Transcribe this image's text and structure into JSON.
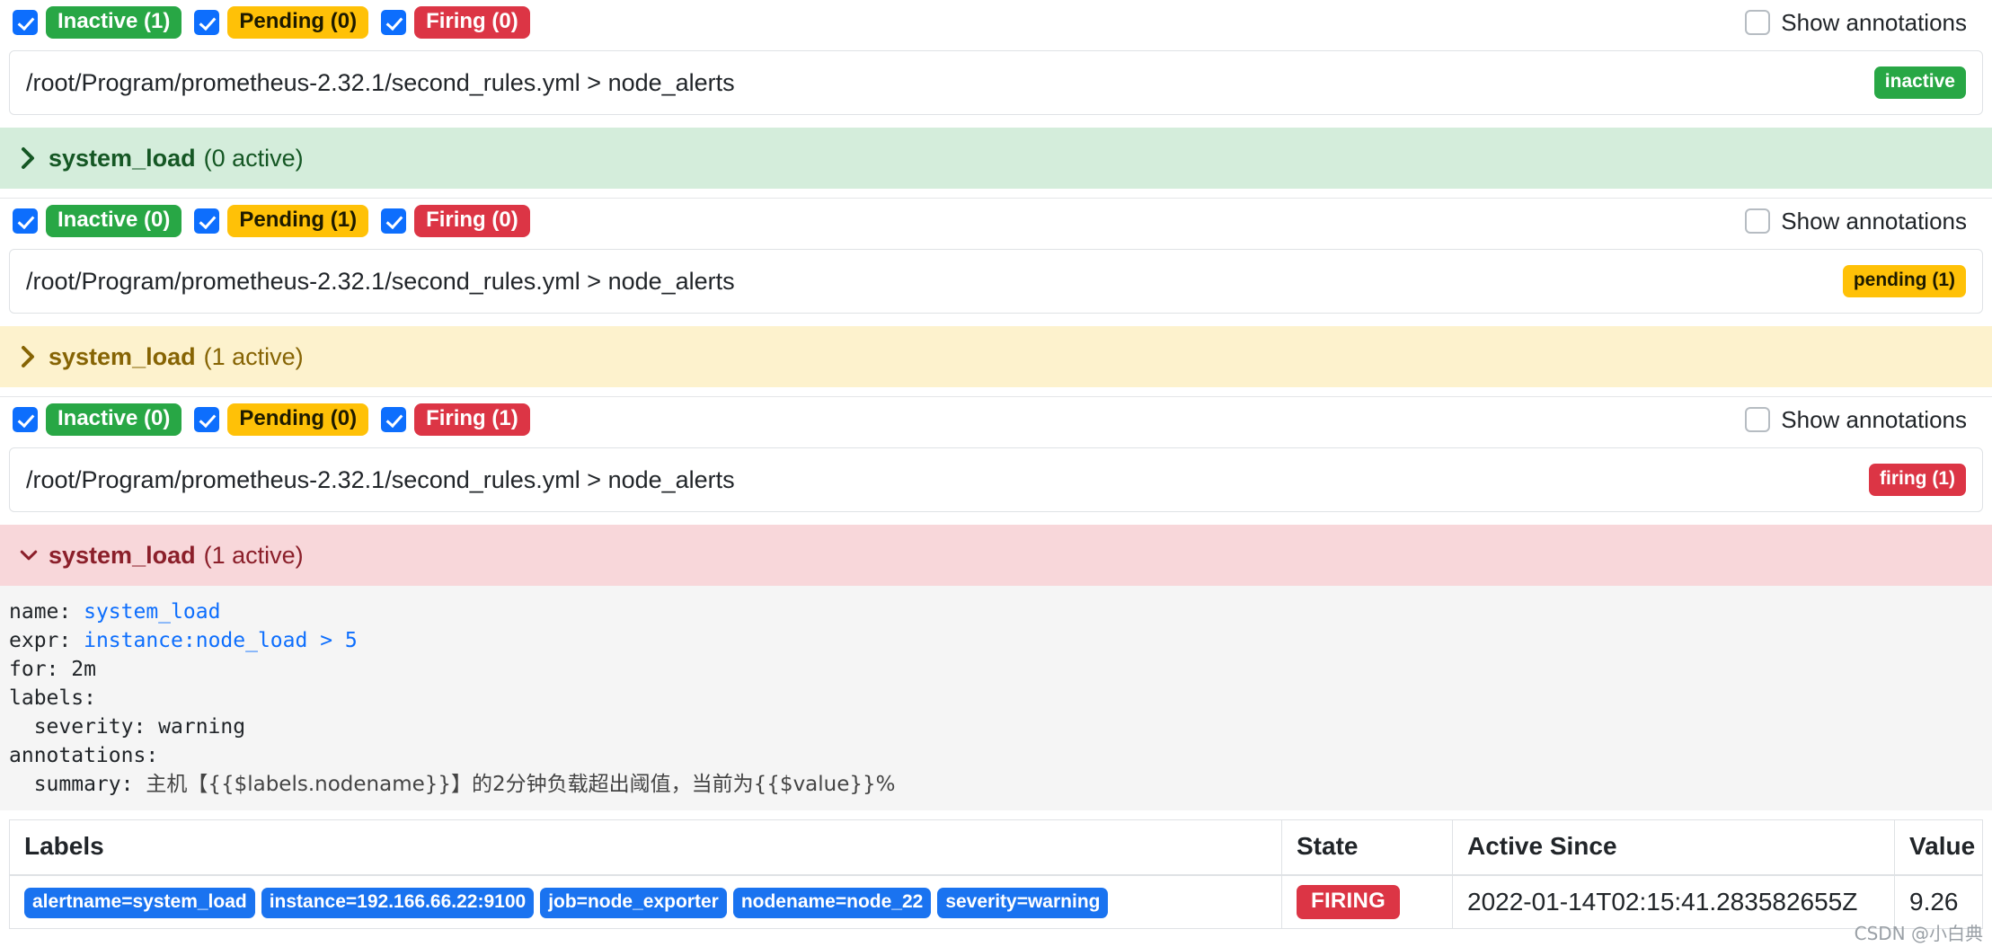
{
  "colors": {
    "inactive": "#28a745",
    "pending": "#ffc107",
    "firing": "#dc3545",
    "checkbox_blue": "#0d6efd",
    "label_blue": "#1a73f0",
    "inactive_bg": "#d4eddb",
    "pending_bg": "#fdf2cd",
    "firing_bg": "#f8d7da"
  },
  "sections": [
    {
      "filters": [
        {
          "label": "Inactive (1)",
          "state": "inactive",
          "checked": true
        },
        {
          "label": "Pending (0)",
          "state": "pending",
          "checked": true
        },
        {
          "label": "Firing (0)",
          "state": "firing",
          "checked": true
        }
      ],
      "show_annotations_label": "Show annotations",
      "show_annotations_checked": false,
      "file_path": "/root/Program/prometheus-2.32.1/second_rules.yml > node_alerts",
      "file_state_badge": "inactive",
      "file_state": "inactive",
      "group_name": "system_load",
      "group_count": "(0 active)",
      "group_state": "inactive",
      "expanded": false
    },
    {
      "filters": [
        {
          "label": "Inactive (0)",
          "state": "inactive",
          "checked": true
        },
        {
          "label": "Pending (1)",
          "state": "pending",
          "checked": true
        },
        {
          "label": "Firing (0)",
          "state": "firing",
          "checked": true
        }
      ],
      "show_annotations_label": "Show annotations",
      "show_annotations_checked": false,
      "file_path": "/root/Program/prometheus-2.32.1/second_rules.yml > node_alerts",
      "file_state_badge": "pending (1)",
      "file_state": "pending",
      "group_name": "system_load",
      "group_count": "(1 active)",
      "group_state": "pending",
      "expanded": false
    },
    {
      "filters": [
        {
          "label": "Inactive (0)",
          "state": "inactive",
          "checked": true
        },
        {
          "label": "Pending (0)",
          "state": "pending",
          "checked": true
        },
        {
          "label": "Firing (1)",
          "state": "firing",
          "checked": true
        }
      ],
      "show_annotations_label": "Show annotations",
      "show_annotations_checked": false,
      "file_path": "/root/Program/prometheus-2.32.1/second_rules.yml > node_alerts",
      "file_state_badge": "firing (1)",
      "file_state": "firing",
      "group_name": "system_load",
      "group_count": "(1 active)",
      "group_state": "firing",
      "expanded": true
    }
  ],
  "rule": {
    "name_key": "name: ",
    "name_value": "system_load",
    "expr_key": "expr: ",
    "expr_value": "instance:node_load > 5",
    "for_line": "for: 2m",
    "labels_line": "labels:",
    "labels_severity": "  severity: warning",
    "annotations_line": "annotations:",
    "annotations_summary_key": "  summary: ",
    "annotations_summary_value": "主机【{{$labels.nodename}}】的2分钟负载超出阈值，当前为{{$value}}%"
  },
  "table": {
    "headers": [
      "Labels",
      "State",
      "Active Since",
      "Value"
    ],
    "rows": [
      {
        "labels": [
          "alertname=system_load",
          "instance=192.166.66.22:9100",
          "job=node_exporter",
          "nodename=node_22",
          "severity=warning"
        ],
        "state": "FIRING",
        "active_since": "2022-01-14T02:15:41.283582655Z",
        "value": "9.26"
      }
    ]
  },
  "watermark": "CSDN @小白典"
}
